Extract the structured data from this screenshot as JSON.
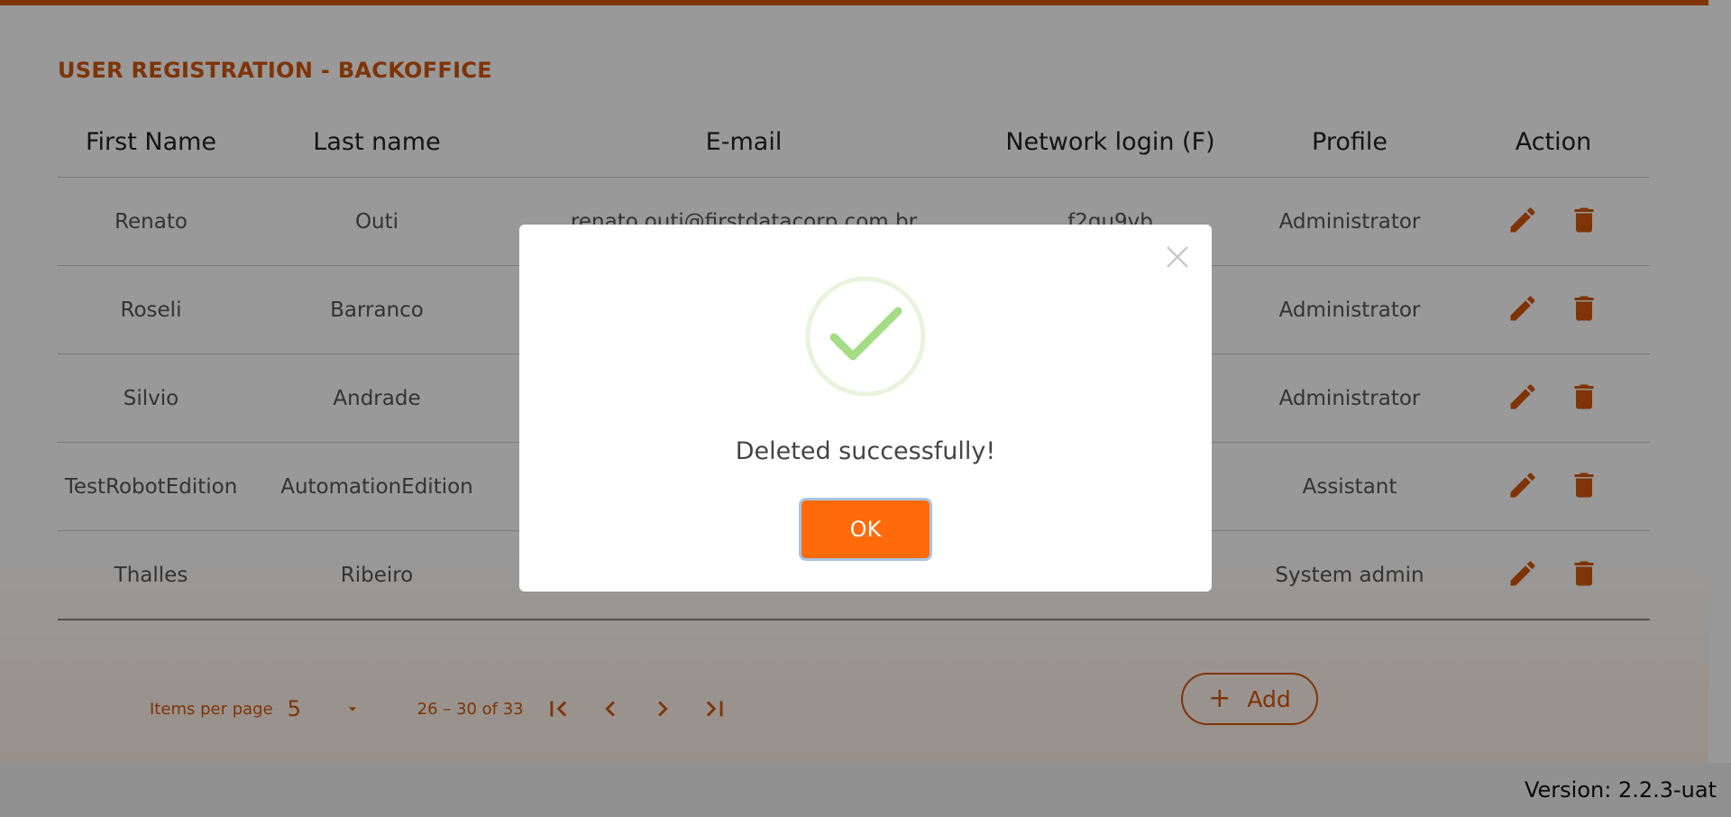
{
  "page": {
    "title": "USER REGISTRATION - BACKOFFICE"
  },
  "table": {
    "headers": [
      "First Name",
      "Last name",
      "E-mail",
      "Network login (F)",
      "Profile",
      "Action"
    ],
    "rows": [
      {
        "first": "Renato",
        "last": "Outi",
        "email": "renato.outi@firstdatacorp.com.br",
        "login": "f2gu9vb",
        "profile": "Administrator"
      },
      {
        "first": "Roseli",
        "last": "Barranco",
        "email": "",
        "login": "",
        "profile": "Administrator"
      },
      {
        "first": "Silvio",
        "last": "Andrade",
        "email": "",
        "login": "",
        "profile": "Administrator"
      },
      {
        "first": "TestRobotEdition",
        "last": "AutomationEdition",
        "email": "",
        "login": "",
        "profile": "Assistant"
      },
      {
        "first": "Thalles",
        "last": "Ribeiro",
        "email": "",
        "login": "",
        "profile": "System admin"
      }
    ],
    "row_actions": [
      "pencil-icon",
      "trash-icon"
    ]
  },
  "pagination": {
    "items_per_page_label": "Items per page",
    "items_per_page_value": "5",
    "range_label": "26 – 30 of 33",
    "icons": [
      "first-page-icon",
      "prev-page-icon",
      "next-page-icon",
      "last-page-icon"
    ]
  },
  "add_button": {
    "label": "Add",
    "icon": "plus-icon"
  },
  "footer": {
    "version": "Version: 2.2.3-uat"
  },
  "dialog": {
    "message": "Deleted successfully!",
    "ok_label": "OK",
    "icons": [
      "success-check-icon",
      "close-icon"
    ]
  },
  "colors": {
    "accent": "#d4570c",
    "ok_button": "#ff6b0a",
    "success": "#a5dc86",
    "overlay": "rgba(0,0,0,0.4)"
  }
}
